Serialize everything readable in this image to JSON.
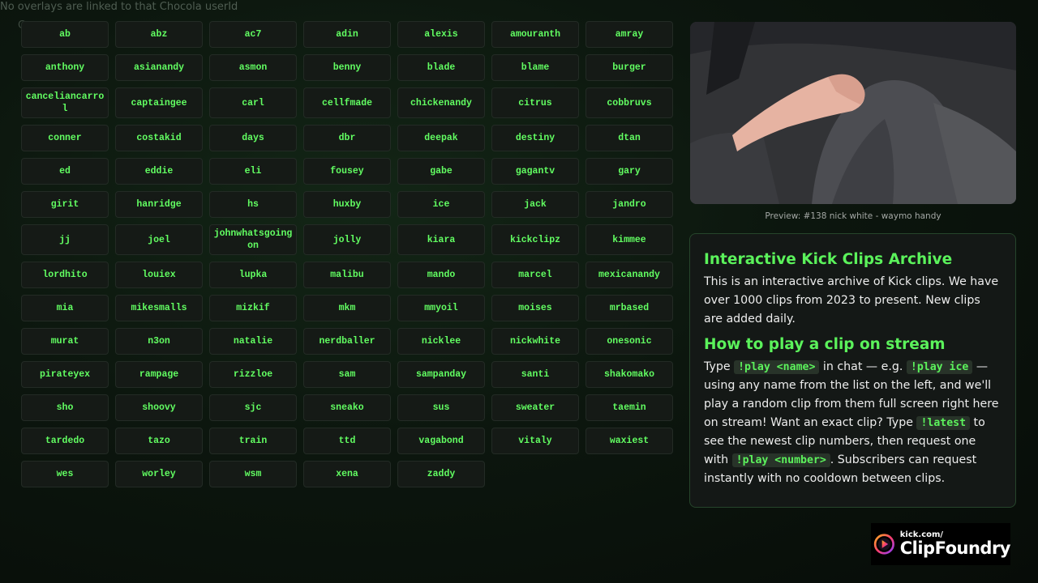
{
  "notice": {
    "text": "No overlays are linked to that Chocola userId",
    "second_line_char": "C"
  },
  "names": [
    "ab",
    "abz",
    "ac7",
    "adin",
    "alexis",
    "amouranth",
    "amray",
    "anthony",
    "asianandy",
    "asmon",
    "benny",
    "blade",
    "blame",
    "burger",
    "canceliancarrol",
    "captaingee",
    "carl",
    "cellfmade",
    "chickenandy",
    "citrus",
    "cobbruvs",
    "conner",
    "costakid",
    "days",
    "dbr",
    "deepak",
    "destiny",
    "dtan",
    "ed",
    "eddie",
    "eli",
    "fousey",
    "gabe",
    "gagantv",
    "gary",
    "girit",
    "hanridge",
    "hs",
    "huxby",
    "ice",
    "jack",
    "jandro",
    "jj",
    "joel",
    "johnwhatsgoingon",
    "jolly",
    "kiara",
    "kickclipz",
    "kimmee",
    "lordhito",
    "louiex",
    "lupka",
    "malibu",
    "mando",
    "marcel",
    "mexicanandy",
    "mia",
    "mikesmalls",
    "mizkif",
    "mkm",
    "mmyoil",
    "moises",
    "mrbased",
    "murat",
    "n3on",
    "natalie",
    "nerdballer",
    "nicklee",
    "nickwhite",
    "onesonic",
    "pirateyex",
    "rampage",
    "rizzloe",
    "sam",
    "sampanday",
    "santi",
    "shakomako",
    "sho",
    "shoovy",
    "sjc",
    "sneako",
    "sus",
    "sweater",
    "taemin",
    "tardedo",
    "tazo",
    "train",
    "ttd",
    "vagabond",
    "vitaly",
    "waxiest",
    "wes",
    "worley",
    "wsm",
    "xena",
    "zaddy"
  ],
  "preview": {
    "caption": "Preview: #138 nick white - waymo handy"
  },
  "info": {
    "title": "Interactive Kick Clips Archive",
    "description": "This is an interactive archive of Kick clips. We have over 1000 clips from 2023 to present. New clips are added daily.",
    "how_title": "How to play a clip on stream",
    "how": {
      "t1": "Type ",
      "c1": "!play <name>",
      "t2": " in chat — e.g. ",
      "c2": "!play ice",
      "t3": " — using any name from the list on the left, and we'll play a random clip from them full screen right here on stream! Want an exact clip? Type ",
      "c3": "!latest",
      "t4": " to see the newest clip numbers, then request one with ",
      "c4": "!play <number>",
      "t5": ". Subscribers can request instantly with no cooldown between clips."
    }
  },
  "logo": {
    "small": "kick.com/",
    "big": "ClipFoundry"
  }
}
